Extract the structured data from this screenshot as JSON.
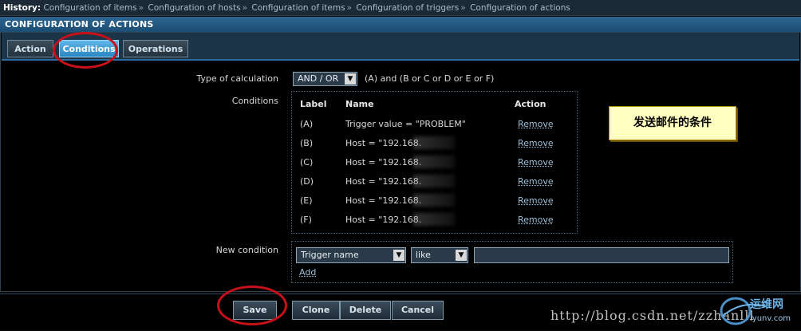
{
  "history": {
    "label": "History:",
    "crumbs": [
      "Configuration of items",
      "Configuration of hosts",
      "Configuration of items",
      "Configuration of triggers",
      "Configuration of actions"
    ],
    "separator": "»"
  },
  "title": "CONFIGURATION OF ACTIONS",
  "tabs": [
    {
      "label": "Action",
      "active": false
    },
    {
      "label": "Conditions",
      "active": true
    },
    {
      "label": "Operations",
      "active": false
    }
  ],
  "calc": {
    "label": "Type of calculation",
    "value": "AND / OR",
    "formula": "(A) and (B or C or D or E or F)"
  },
  "conditions": {
    "label": "Conditions",
    "headers": {
      "label": "Label",
      "name": "Name",
      "action": "Action"
    },
    "rows": [
      {
        "label": "(A)",
        "name": "Trigger value = \"PROBLEM\"",
        "action": "Remove",
        "blurred": false
      },
      {
        "label": "(B)",
        "name": "Host = \"192.168.",
        "action": "Remove",
        "blurred": true
      },
      {
        "label": "(C)",
        "name": "Host = \"192.168.",
        "action": "Remove",
        "blurred": true
      },
      {
        "label": "(D)",
        "name": "Host = \"192.168.",
        "action": "Remove",
        "blurred": true
      },
      {
        "label": "(E)",
        "name": "Host = \"192.168.",
        "action": "Remove",
        "blurred": true
      },
      {
        "label": "(F)",
        "name": "Host = \"192.168.",
        "action": "Remove",
        "blurred": true
      }
    ]
  },
  "annotation": "发送邮件的条件",
  "new_condition": {
    "label": "New condition",
    "type_value": "Trigger name",
    "operator_value": "like",
    "text_value": "",
    "add_label": "Add"
  },
  "buttons": {
    "save": "Save",
    "clone": "Clone",
    "delete": "Delete",
    "cancel": "Cancel"
  },
  "watermark": "http://blog.csdn.net/zzhanlll",
  "logo": {
    "text": "运维网",
    "subtext": "iyunv.com"
  },
  "colors": {
    "accent": "#2a86c2",
    "title": "#1d4d72",
    "highlight_circle": "#c8101a",
    "note_bg": "#ffffc0"
  }
}
